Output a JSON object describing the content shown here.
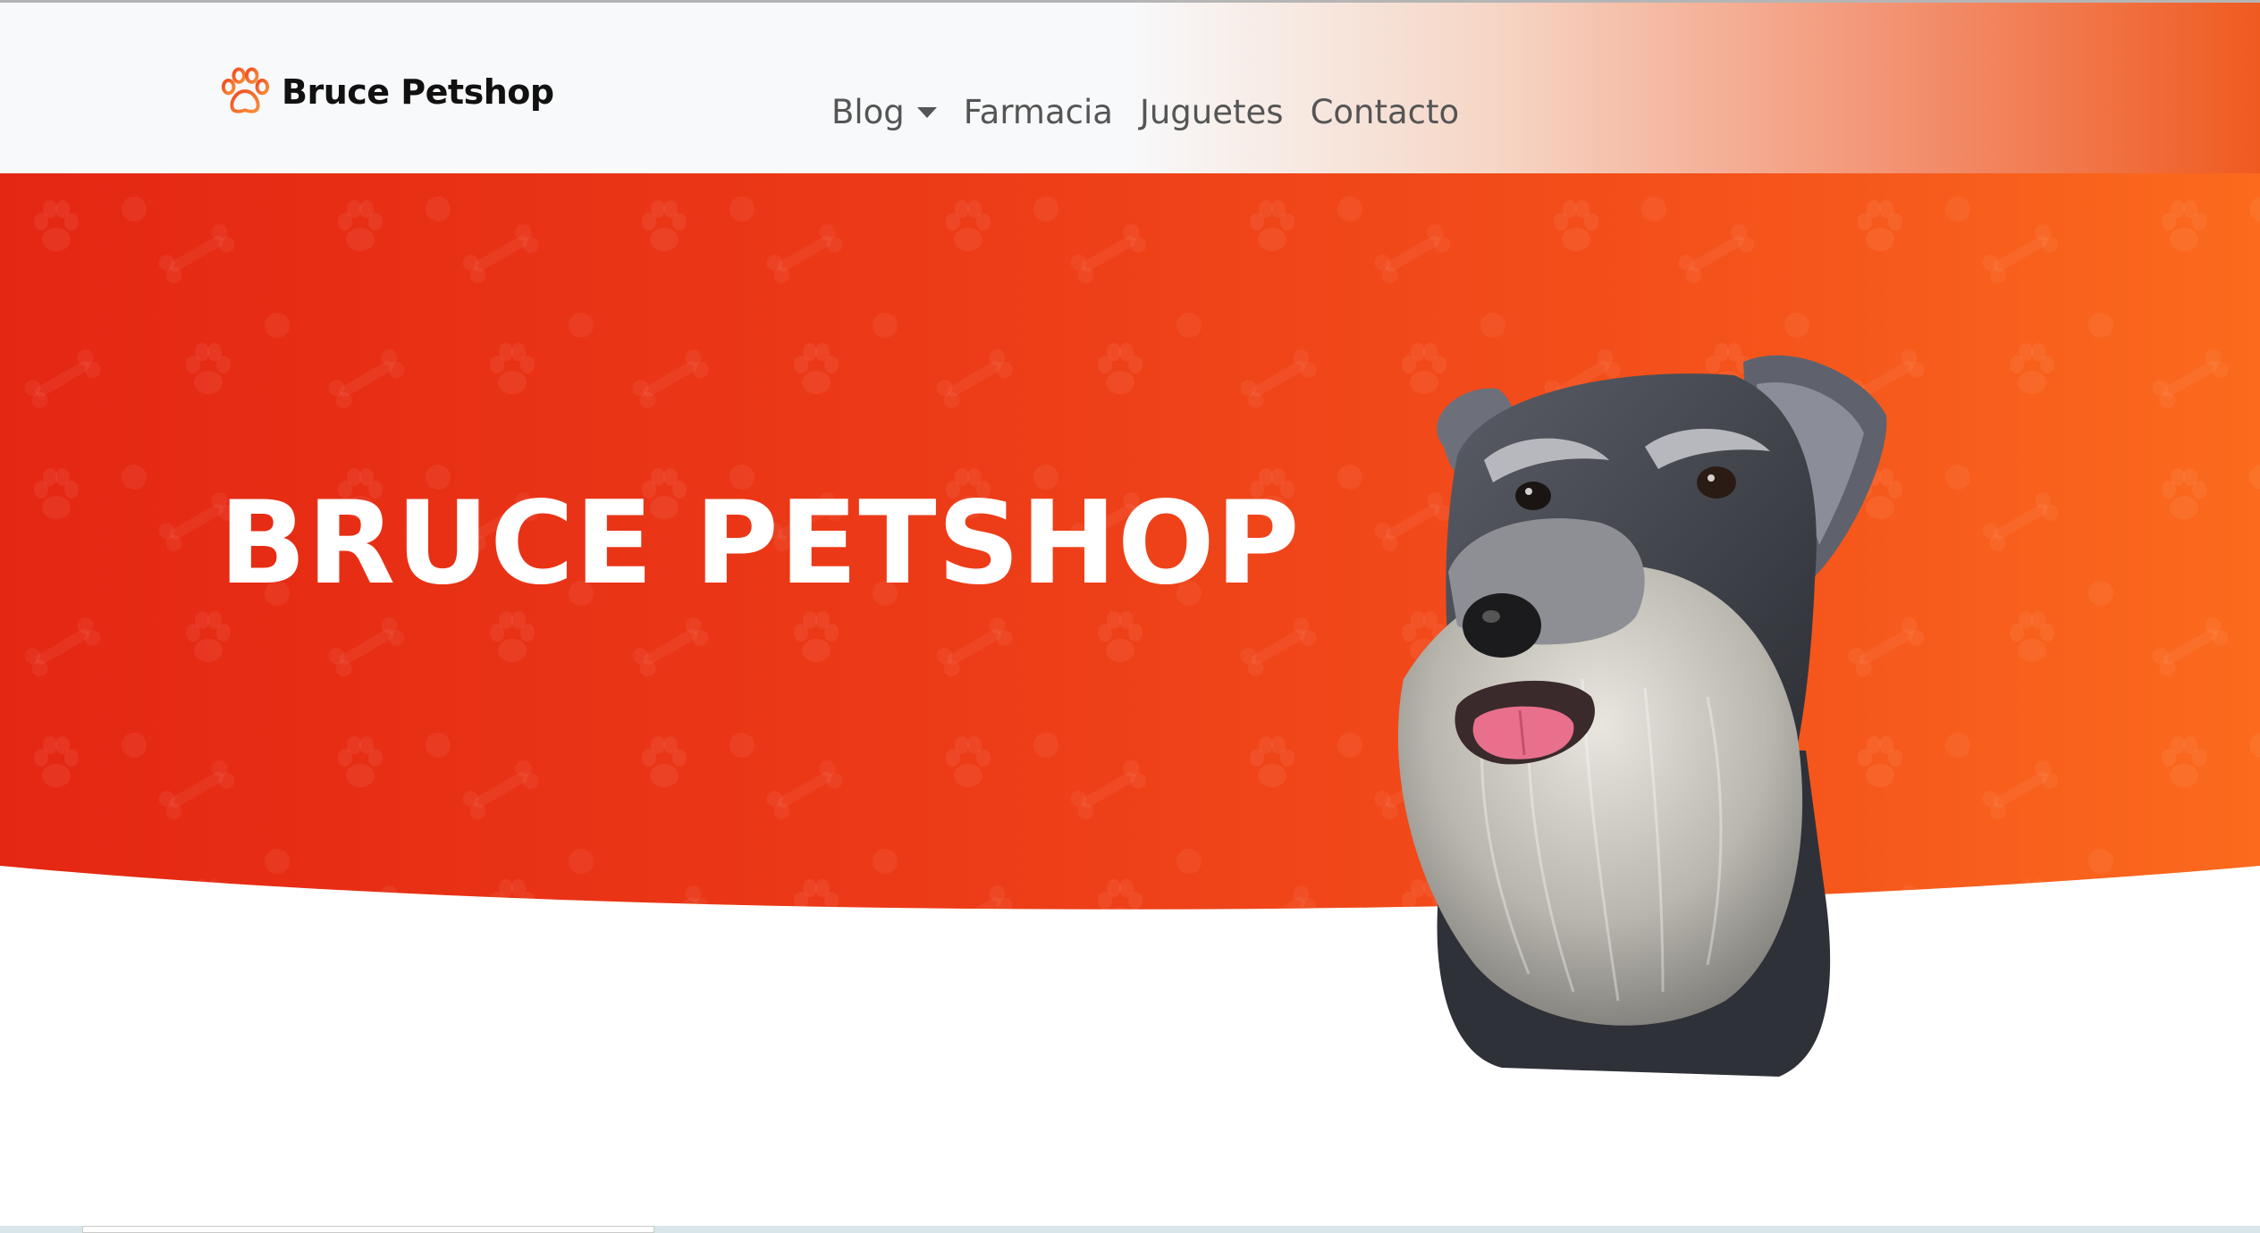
{
  "navbar": {
    "brand": "Bruce Petshop",
    "links": [
      {
        "label": "Blog",
        "dropdown": true
      },
      {
        "label": "Farmacia",
        "dropdown": false
      },
      {
        "label": "Juguetes",
        "dropdown": false
      },
      {
        "label": "Contacto",
        "dropdown": false
      }
    ]
  },
  "hero": {
    "title": "BRUCE PETSHOP"
  },
  "icons": {
    "brand_icon": "paw-icon",
    "dropdown_icon": "caret-down-icon"
  },
  "colors": {
    "accent": "#ef3a17",
    "hero_start": "#e42713",
    "hero_end": "#fb6a1d",
    "navbar_bg": "#f8f9fa",
    "text_dark": "#111111",
    "nav_text": "#555555"
  }
}
